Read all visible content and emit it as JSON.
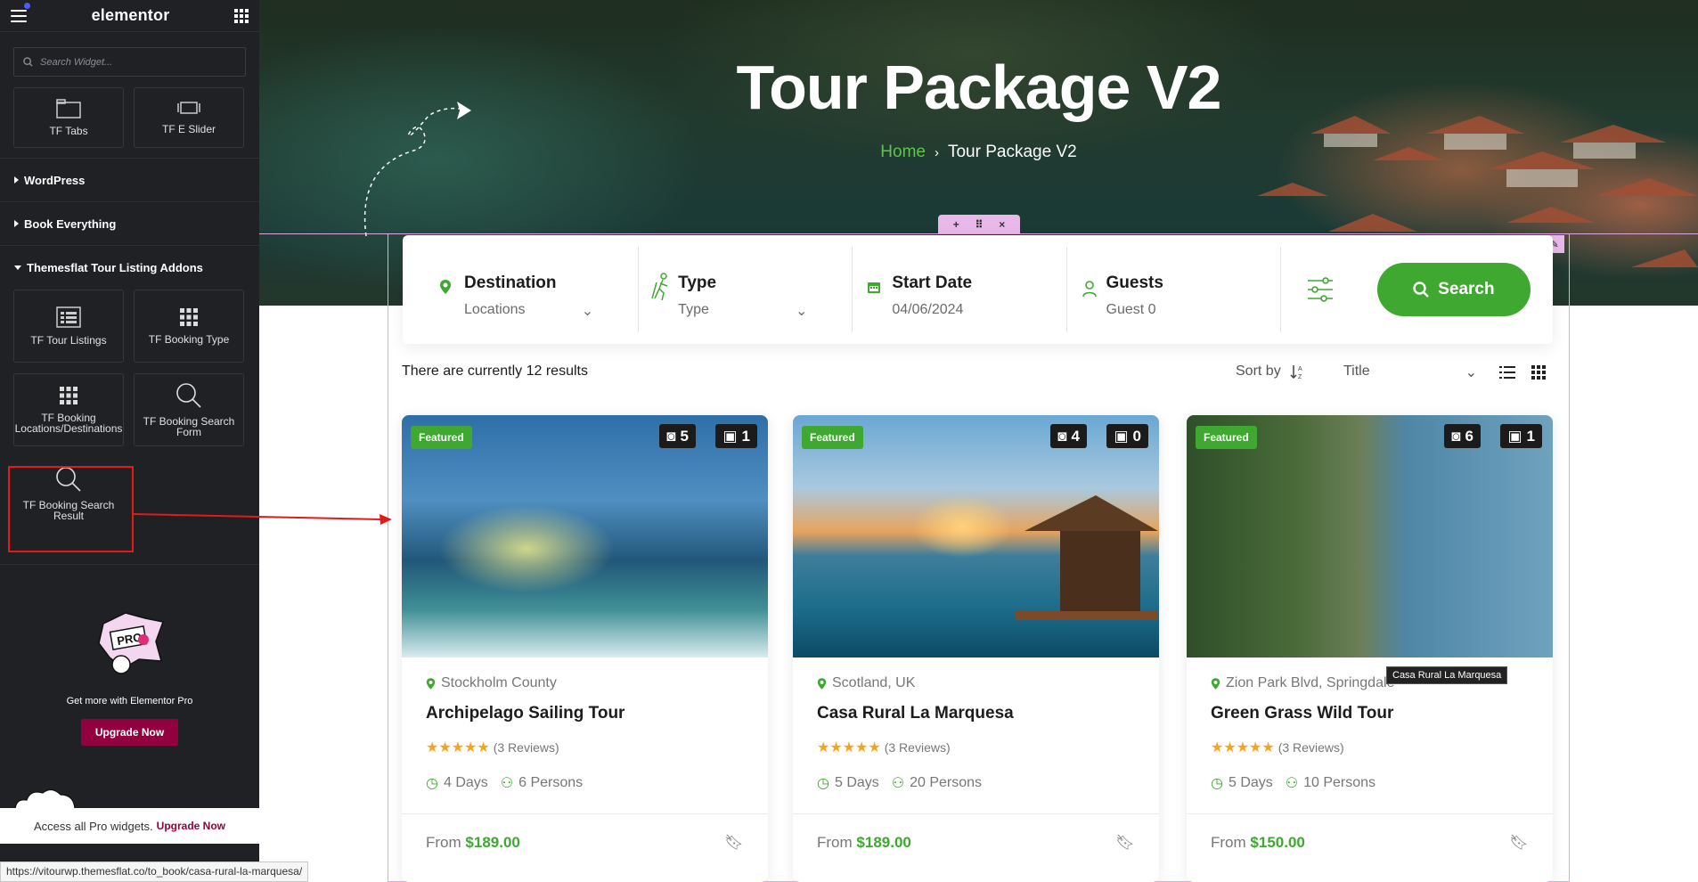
{
  "sidebar": {
    "logo": "elementor",
    "search_placeholder": "Search Widget...",
    "top_widgets": [
      {
        "label": "TF Tabs",
        "icon": "tabs-icon"
      },
      {
        "label": "TF E Slider",
        "icon": "slider-icon"
      }
    ],
    "categories": [
      "WordPress",
      "Book Everything",
      "Themesflat Tour Listing Addons"
    ],
    "addon_widgets": [
      {
        "label": "TF Tour Listings",
        "icon": "listing-icon"
      },
      {
        "label": "TF Booking Type",
        "icon": "grid-icon"
      },
      {
        "label": "TF Booking Locations/Destinations",
        "icon": "grid-icon"
      },
      {
        "label": "TF Booking Search Form",
        "icon": "search-icon"
      },
      {
        "label": "TF Booking Search Result",
        "icon": "search-icon"
      }
    ],
    "pro_text": "Get more with Elementor Pro",
    "upgrade_btn": "Upgrade Now",
    "access_text": "Access all Pro widgets.",
    "access_link": "Upgrade Now",
    "status_url": "https://vitourwp.themesflat.co/to_book/casa-rural-la-marquesa/"
  },
  "hero": {
    "title": "Tour Package V2",
    "crumb_home": "Home",
    "crumb_current": "Tour Package V2"
  },
  "search": {
    "fields": [
      {
        "label": "Destination",
        "value": "Locations",
        "dropdown": true,
        "icon": "map-pin-icon"
      },
      {
        "label": "Type",
        "value": "Type",
        "dropdown": true,
        "icon": "hiker-icon"
      },
      {
        "label": "Start Date",
        "value": "04/06/2024",
        "dropdown": false,
        "icon": "calendar-icon"
      },
      {
        "label": "Guests",
        "value": "Guest 0",
        "dropdown": false,
        "icon": "user-icon"
      }
    ],
    "button": "Search"
  },
  "results": {
    "count_text": "There are currently 12 results",
    "sort_by": "Sort by",
    "sort_value": "Title"
  },
  "cards": [
    {
      "featured": "Featured",
      "photos": "5",
      "videos": "1",
      "location": "Stockholm County",
      "title": "Archipelago Sailing Tour",
      "reviews": "(3 Reviews)",
      "days": "4 Days",
      "persons": "6 Persons",
      "from": "From",
      "price": "$189.00"
    },
    {
      "featured": "Featured",
      "photos": "4",
      "videos": "0",
      "location": "Scotland, UK",
      "title": "Casa Rural La Marquesa",
      "reviews": "(3 Reviews)",
      "days": "5 Days",
      "persons": "20 Persons",
      "from": "From",
      "price": "$189.00"
    },
    {
      "featured": "Featured",
      "photos": "6",
      "videos": "1",
      "location": "Zion Park Blvd, Springdale",
      "title": "Green Grass Wild Tour",
      "reviews": "(3 Reviews)",
      "days": "5 Days",
      "persons": "10 Persons",
      "from": "From",
      "price": "$150.00"
    }
  ],
  "tooltip": "Casa Rural La Marquesa",
  "colors": {
    "accent": "#3ea830",
    "pro": "#93003f",
    "sidebar": "#1f2124"
  }
}
